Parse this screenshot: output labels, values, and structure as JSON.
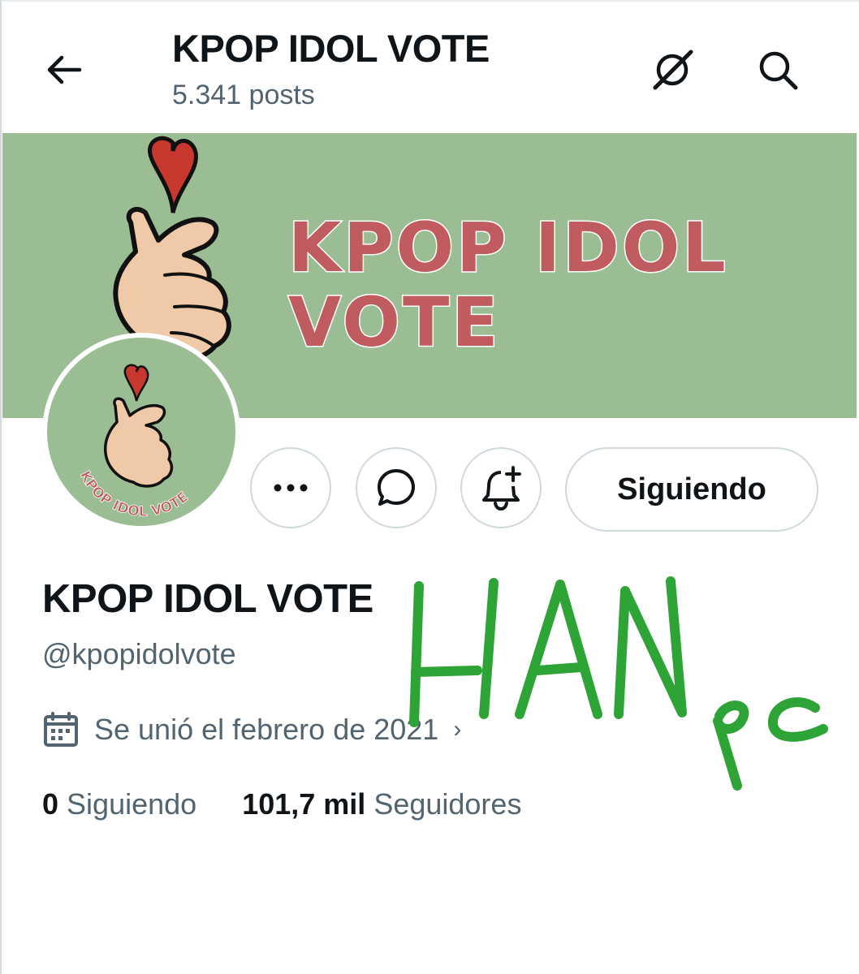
{
  "header": {
    "title": "KPOP IDOL VOTE",
    "post_count": "5.341 posts",
    "icons": [
      "back-arrow-icon",
      "grok-icon",
      "search-icon"
    ]
  },
  "banner": {
    "line1": "KPOP IDOL",
    "line2": "VOTE",
    "bg_color": "#9bbd94",
    "text_color": "#c05b5f"
  },
  "avatar": {
    "label": "KPOP IDOL VOTE"
  },
  "actions": {
    "follow_label": "Siguiendo",
    "icons": [
      "more-icon",
      "message-icon",
      "notification-add-icon"
    ]
  },
  "profile": {
    "name": "KPOP IDOL VOTE",
    "handle": "@kpopidolvote",
    "joined": "Se unió el febrero de 2021",
    "following_count": "0",
    "following_label": "Siguiendo",
    "followers_count": "101,7 mil",
    "followers_label": "Seguidores"
  },
  "annotation": {
    "text": "HAN pc",
    "color": "#2ea336"
  }
}
